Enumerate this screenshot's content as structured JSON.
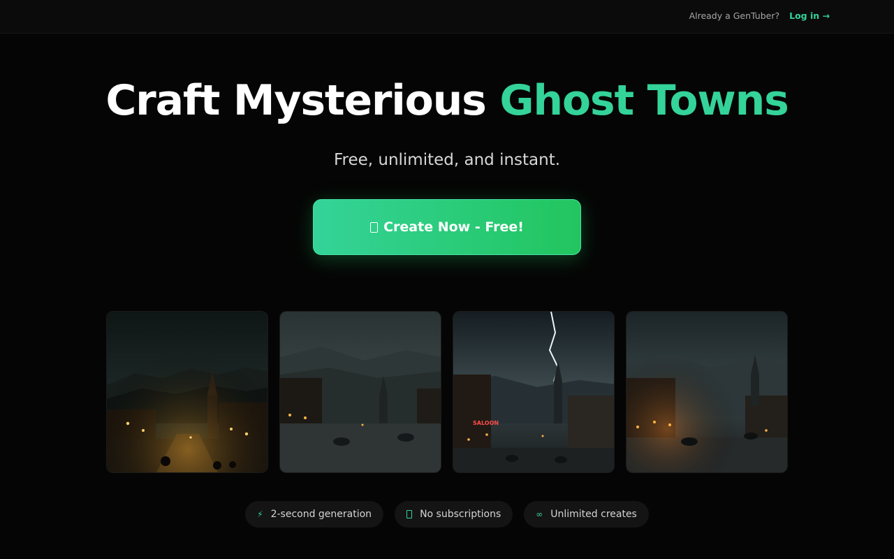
{
  "header": {
    "prompt_text": "Already a GenTuber?",
    "login_label": "Log in",
    "login_arrow": "→"
  },
  "hero": {
    "title_main": "Craft Mysterious ",
    "title_accent": "Ghost Towns",
    "subtitle": "Free, unlimited, and instant.",
    "cta_label": "Create Now - Free!",
    "cta_icon": "phone-icon"
  },
  "gallery": [
    {
      "name": "ghost-town-lantern-street"
    },
    {
      "name": "ghost-town-foggy-horses"
    },
    {
      "name": "ghost-town-lightning-saloon",
      "sign": "SALOON"
    },
    {
      "name": "ghost-town-dusk-riders"
    }
  ],
  "features": [
    {
      "icon": "lightning-icon",
      "glyph": "⚡",
      "label": "2-second generation"
    },
    {
      "icon": "phone-icon",
      "glyph": "",
      "label": "No subscriptions"
    },
    {
      "icon": "infinity-icon",
      "glyph": "∞",
      "label": "Unlimited creates"
    }
  ],
  "colors": {
    "accent": "#34d399",
    "accent_dark": "#22c55e",
    "background": "#050505",
    "pill_bg": "#141414"
  }
}
